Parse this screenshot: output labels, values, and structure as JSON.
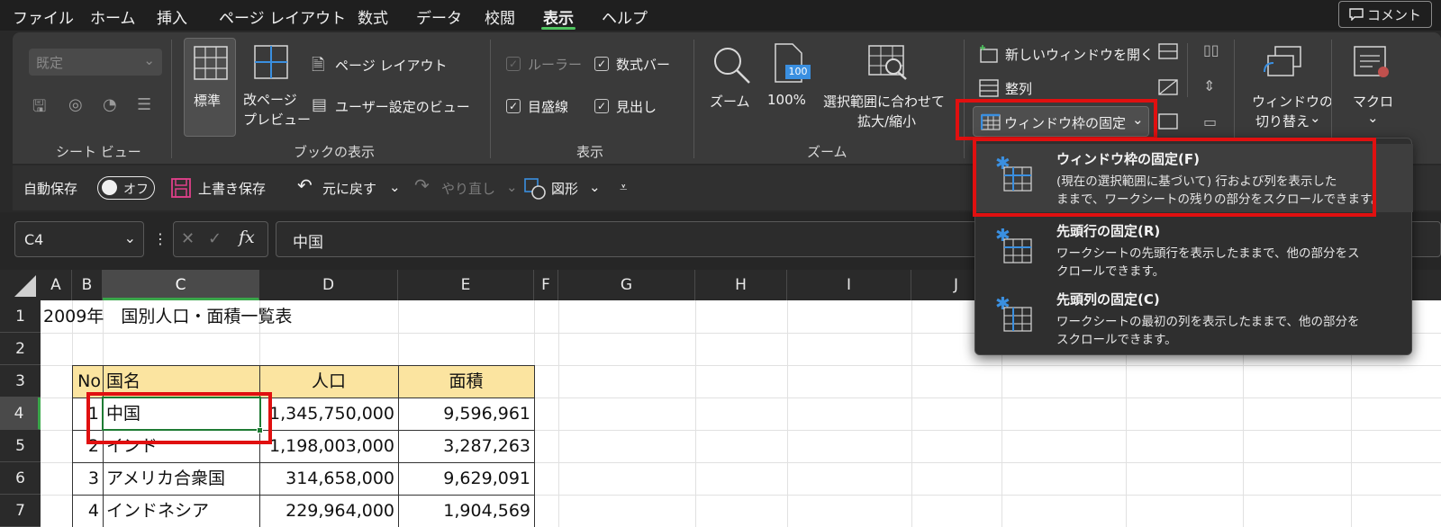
{
  "menu": {
    "tabs": [
      "ファイル",
      "ホーム",
      "挿入",
      "ページ レイアウト",
      "数式",
      "データ",
      "校閲",
      "表示",
      "ヘルプ"
    ],
    "active_tab": "表示",
    "comment_button": "コメント"
  },
  "ribbon": {
    "sheet_view": {
      "combo_value": "既定",
      "group_label": "シート ビュー"
    },
    "book_view": {
      "normal": "標準",
      "page_break_line1": "改ページ",
      "page_break_line2": "プレビュー",
      "page_layout": "ページ レイアウト",
      "custom_views": "ユーザー設定のビュー",
      "group_label": "ブックの表示"
    },
    "show": {
      "ruler": "ルーラー",
      "formula_bar": "数式バー",
      "gridlines": "目盛線",
      "headings": "見出し",
      "group_label": "表示"
    },
    "zoom": {
      "zoom": "ズーム",
      "hundred": "100%",
      "hundred_icon": "100",
      "zoom_to_selection_line1": "選択範囲に合わせて",
      "zoom_to_selection_line2": "拡大/縮小",
      "group_label": "ズーム"
    },
    "window": {
      "new_window": "新しいウィンドウを開く",
      "arrange": "整列",
      "freeze_panes": "ウィンドウ枠の固定",
      "switch_line1": "ウィンドウの",
      "switch_line2": "切り替え",
      "macro": "マクロ"
    }
  },
  "qat": {
    "autosave": "自動保存",
    "toggle": "オフ",
    "overwrite_save": "上書き保存",
    "undo": "元に戻す",
    "redo": "やり直し",
    "shapes": "図形"
  },
  "formula_bar": {
    "name_box": "C4",
    "fx": "fx",
    "formula": "中国"
  },
  "grid": {
    "columns": [
      "A",
      "B",
      "C",
      "D",
      "E",
      "F",
      "G",
      "H",
      "I",
      "J"
    ],
    "rows": [
      "1",
      "2",
      "3",
      "4",
      "5",
      "6",
      "7"
    ],
    "title": "2009年　国別人口・面積一覧表",
    "headers": {
      "no": "No",
      "country": "国名",
      "population": "人口",
      "area": "面積"
    },
    "data": [
      {
        "no": "1",
        "country": "中国",
        "population": "1,345,750,000",
        "area": "9,596,961"
      },
      {
        "no": "2",
        "country": "インド",
        "population": "1,198,003,000",
        "area": "3,287,263"
      },
      {
        "no": "3",
        "country": "アメリカ合衆国",
        "population": "314,658,000",
        "area": "9,629,091"
      },
      {
        "no": "4",
        "country": "インドネシア",
        "population": "229,964,000",
        "area": "1,904,569"
      }
    ]
  },
  "dropdown": {
    "items": [
      {
        "title": "ウィンドウ枠の固定(F)",
        "desc1": "(現在の選択範囲に基づいて) 行および列を表示した",
        "desc2": "ままで、ワークシートの残りの部分をスクロールできます。"
      },
      {
        "title": "先頭行の固定(R)",
        "desc1": "ワークシートの先頭行を表示したままで、他の部分をス",
        "desc2": "クロールできます。"
      },
      {
        "title": "先頭列の固定(C)",
        "desc1": "ワークシートの最初の列を表示したままで、他の部分を",
        "desc2": "スクロールできます。"
      }
    ]
  },
  "colors": {
    "accent_green": "#3aa64a",
    "highlight_red": "#e01010",
    "header_fill": "#fbe4a0",
    "icon_blue": "#3a8fe0"
  }
}
